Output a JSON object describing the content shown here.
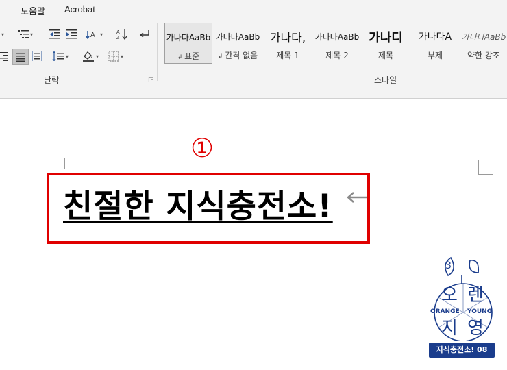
{
  "tabs": [
    "도움말",
    "Acrobat"
  ],
  "groups": {
    "paragraph": "단락",
    "styles": "스타일"
  },
  "styles": [
    {
      "preview": "가나다AaBb",
      "name": "표준",
      "mark": true,
      "active": true
    },
    {
      "preview": "가나다AaBb",
      "name": "간격 없음",
      "mark": true
    },
    {
      "preview": "가나다,",
      "name": "제목 1"
    },
    {
      "preview": "가나다AaBb",
      "name": "제목 2"
    },
    {
      "preview": "가나디",
      "name": "제목"
    },
    {
      "preview": "가나다A",
      "name": "부제"
    },
    {
      "preview": "가나다AaBb",
      "name": "약한 강조"
    }
  ],
  "document": {
    "marker": "①",
    "heading": "친절한 지식충전소!"
  },
  "logo": {
    "number": "3",
    "syllables": [
      "오",
      "렌",
      "지",
      "영"
    ],
    "english_left": "ORANGE",
    "english_right": "YOUNG",
    "badge": "지식충전소! 08"
  },
  "colors": {
    "accent_red": "#e00000",
    "logo_blue": "#1a3c8c"
  }
}
